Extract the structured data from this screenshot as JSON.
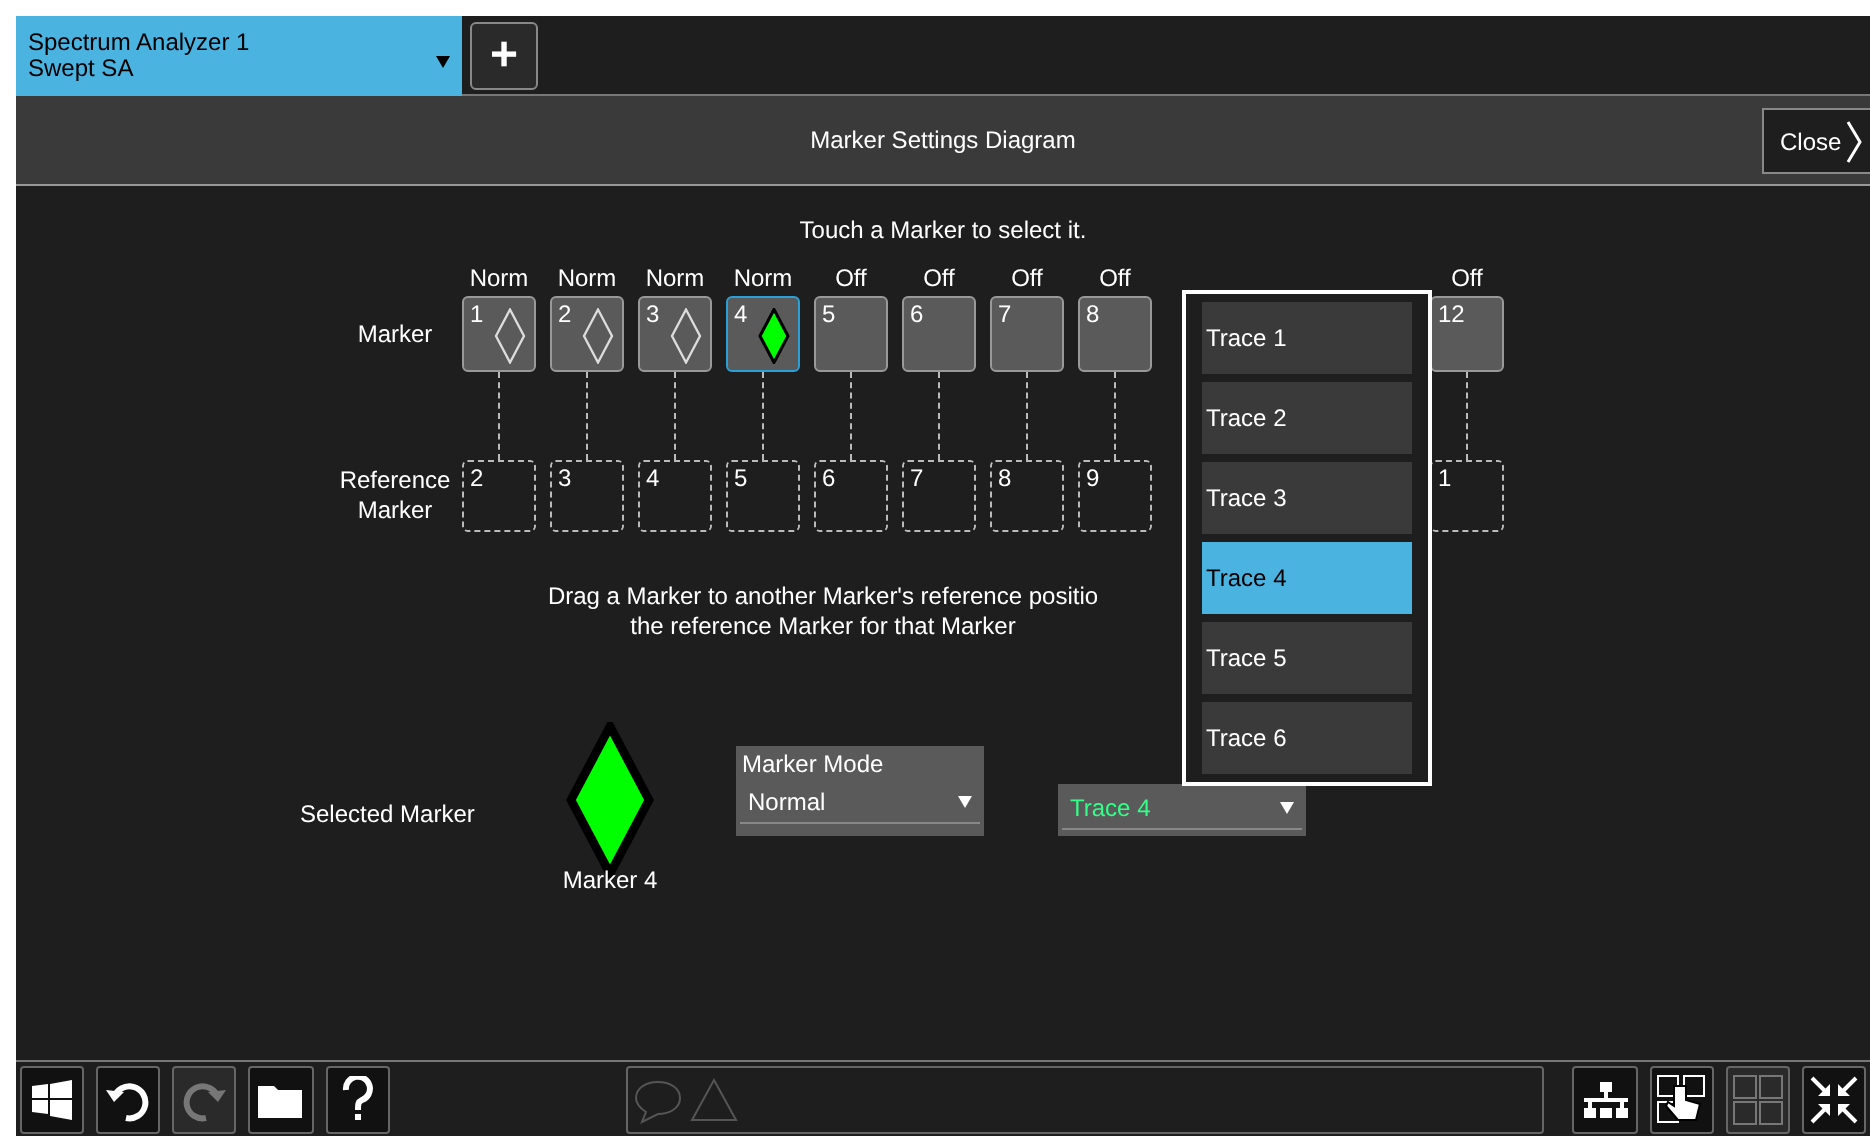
{
  "instrument_tab": {
    "title": "Spectrum Analyzer 1",
    "subtitle": "Swept SA",
    "add_label": "+"
  },
  "header": {
    "title": "Marker Settings Diagram",
    "close_label": "Close"
  },
  "instruction": "Touch a Marker to select it.",
  "row_labels": {
    "marker": "Marker",
    "reference": "Reference Marker"
  },
  "markers": [
    {
      "number": "1",
      "mode": "Norm",
      "kind": "normal",
      "selected": false,
      "reference": "2"
    },
    {
      "number": "2",
      "mode": "Norm",
      "kind": "normal",
      "selected": false,
      "reference": "3"
    },
    {
      "number": "3",
      "mode": "Norm",
      "kind": "normal",
      "selected": false,
      "reference": "4"
    },
    {
      "number": "4",
      "mode": "Norm",
      "kind": "normal",
      "selected": true,
      "reference": "5"
    },
    {
      "number": "5",
      "mode": "Off",
      "kind": "off",
      "selected": false,
      "reference": "6"
    },
    {
      "number": "6",
      "mode": "Off",
      "kind": "off",
      "selected": false,
      "reference": "7"
    },
    {
      "number": "7",
      "mode": "Off",
      "kind": "off",
      "selected": false,
      "reference": "8"
    },
    {
      "number": "8",
      "mode": "Off",
      "kind": "off",
      "selected": false,
      "reference": "9"
    },
    {
      "number": "12",
      "mode": "Off",
      "kind": "off",
      "selected": false,
      "reference": "1"
    }
  ],
  "drag_hint_lines": [
    "Drag a Marker to another Marker's reference positio",
    "the reference Marker for that Marker"
  ],
  "selected_marker": {
    "label": "Selected Marker",
    "caption": "Marker 4"
  },
  "marker_mode": {
    "label": "Marker Mode",
    "value": "Normal"
  },
  "trace_select": {
    "value": "Trace 4",
    "options": [
      {
        "label": "Trace 1",
        "selected": false
      },
      {
        "label": "Trace 2",
        "selected": false
      },
      {
        "label": "Trace 3",
        "selected": false
      },
      {
        "label": "Trace 4",
        "selected": true
      },
      {
        "label": "Trace 5",
        "selected": false
      },
      {
        "label": "Trace 6",
        "selected": false
      }
    ]
  },
  "toolbar": {
    "left": [
      {
        "kind": "windows",
        "disabled": false
      },
      {
        "kind": "undo",
        "disabled": false
      },
      {
        "kind": "redo",
        "disabled": true
      },
      {
        "kind": "folder",
        "disabled": false
      },
      {
        "kind": "help",
        "disabled": false
      }
    ],
    "right": [
      {
        "kind": "network",
        "disabled": false
      },
      {
        "kind": "touch",
        "disabled": false
      },
      {
        "kind": "grid",
        "disabled": true
      },
      {
        "kind": "collapse",
        "disabled": false
      }
    ]
  }
}
